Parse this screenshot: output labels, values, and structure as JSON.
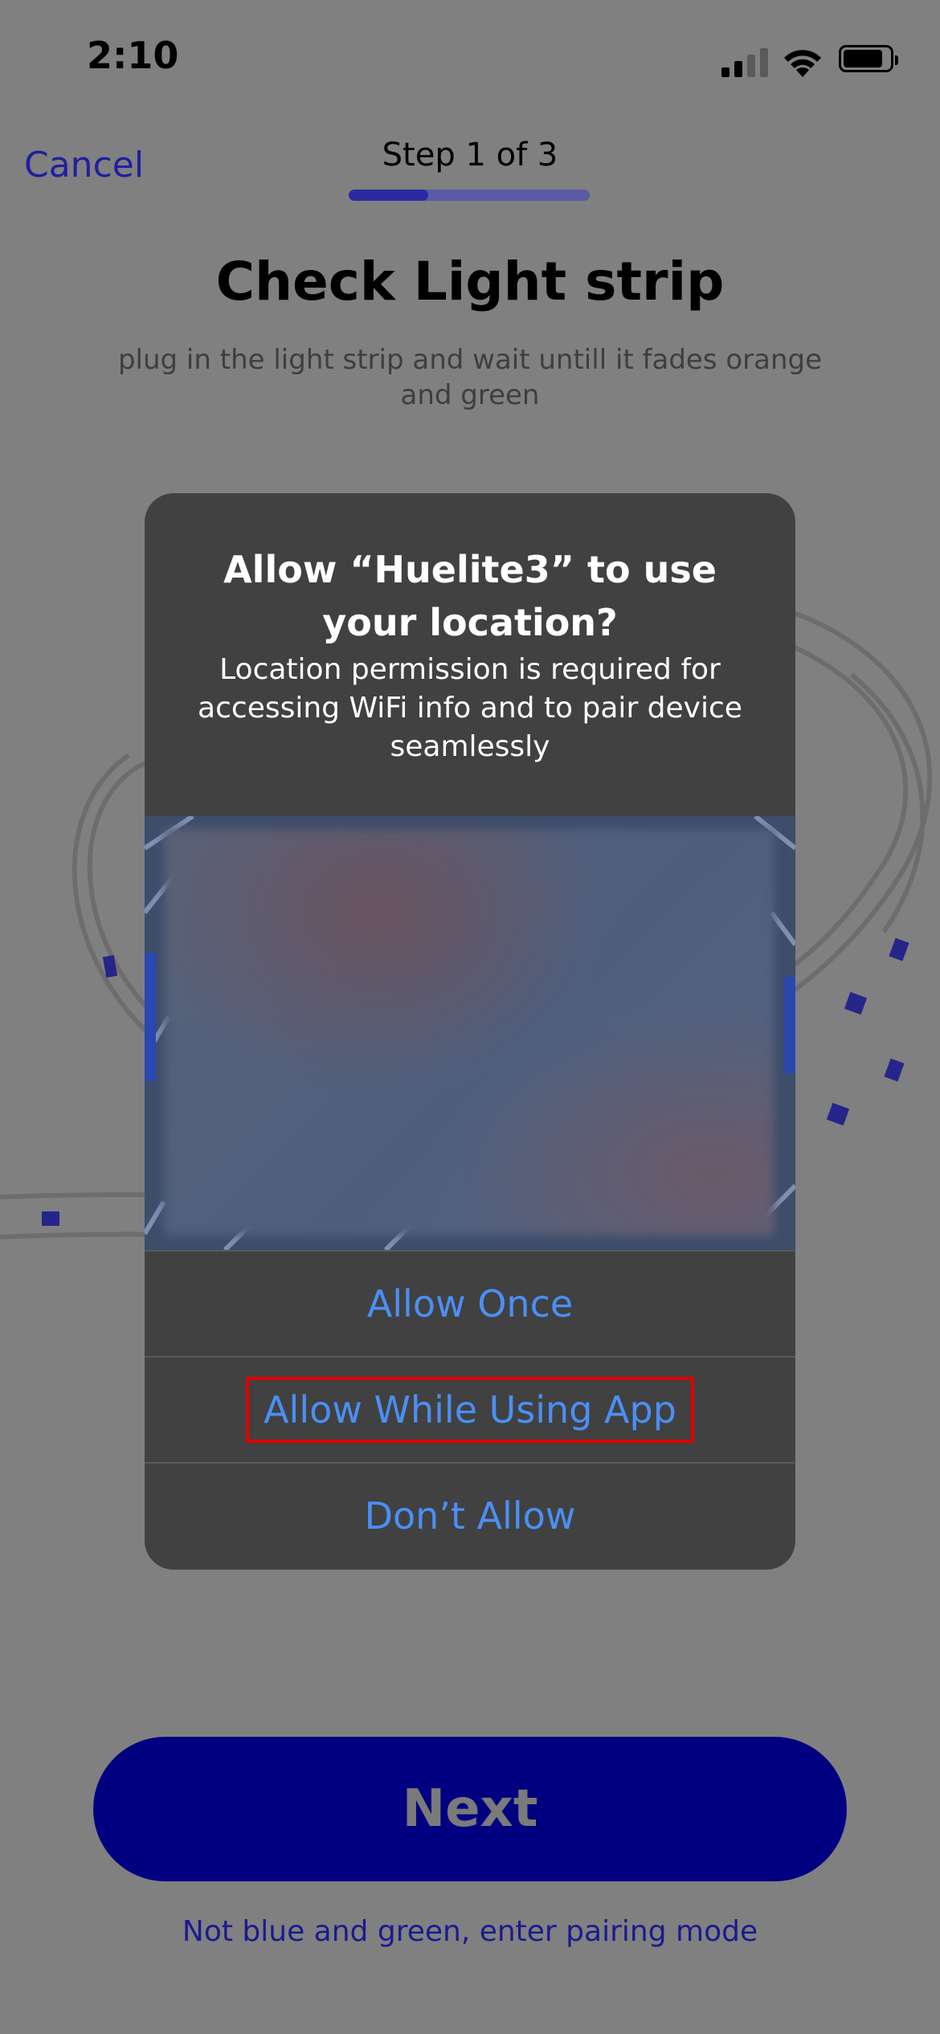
{
  "status_bar": {
    "time": "2:10",
    "icons": [
      "cellular-signal-icon",
      "wifi-icon",
      "battery-icon"
    ]
  },
  "header": {
    "cancel_label": "Cancel",
    "step_label": "Step 1 of 3",
    "progress": 0.33
  },
  "main": {
    "title": "Check Light strip",
    "subtitle": "plug in the light strip and wait untill it fades orange and green"
  },
  "alert": {
    "title": "Allow “Huelite3” to use your location?",
    "message": "Location permission is required for accessing WiFi info and to pair device seamlessly",
    "actions": [
      {
        "label": "Allow Once"
      },
      {
        "label": "Allow While Using App",
        "highlighted": true
      },
      {
        "label": "Don’t Allow"
      }
    ]
  },
  "footer": {
    "next_label": "Next",
    "pairing_link": "Not blue and green, enter pairing mode"
  },
  "colors": {
    "overlay_bg": "#808080",
    "next_button_bg": "#000080",
    "alert_bg": "#414141",
    "alert_action": "#4b8ff5",
    "highlight_border": "#e10000"
  }
}
